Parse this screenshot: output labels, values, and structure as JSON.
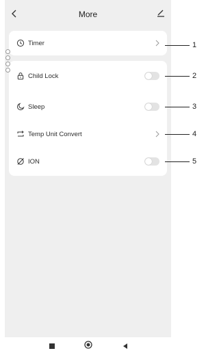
{
  "header": {
    "title": "More",
    "back_icon": "chevron-left-icon",
    "edit_icon": "edit-icon"
  },
  "items": [
    {
      "label": "Timer",
      "icon": "clock-icon",
      "control": "chevron",
      "callout": "1"
    },
    {
      "label": "Child Lock",
      "icon": "lock-icon",
      "control": "toggle",
      "state": "off",
      "callout": "2"
    },
    {
      "label": "Sleep",
      "icon": "moon-icon",
      "control": "toggle",
      "state": "off",
      "callout": "3"
    },
    {
      "label": "Temp Unit Convert",
      "icon": "convert-arrows-icon",
      "control": "chevron",
      "callout": "4"
    },
    {
      "label": "ION",
      "icon": "ion-icon",
      "control": "toggle",
      "state": "off",
      "callout": "5"
    }
  ],
  "navbar": {
    "home_icon": "square-icon",
    "recent_icon": "circle-icon",
    "back_icon": "triangle-back-icon"
  },
  "colors": {
    "background": "#efefef",
    "card": "#ffffff",
    "toggle_off": "#e3e3e3"
  }
}
